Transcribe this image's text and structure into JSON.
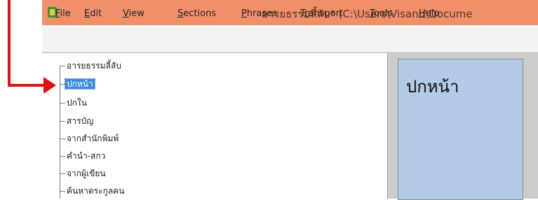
{
  "window": {
    "title": "อารยธรรมลี้ลับ* (C:\\Users\\Visanu\\Docume"
  },
  "menu": [
    {
      "accel": "F",
      "rest": "ile"
    },
    {
      "accel": "E",
      "rest": "dit"
    },
    {
      "accel": "V",
      "rest": "iew"
    },
    {
      "accel": "S",
      "rest": "ections"
    },
    {
      "accel": "P",
      "rest": "hrases"
    },
    {
      "pre": "T",
      "accel": "r",
      "rest": "ansport"
    },
    {
      "accel": "T",
      "rest": "ools"
    },
    {
      "accel": "H",
      "rest": "elp"
    }
  ],
  "tree": {
    "items": [
      "อารยธรรมลี้ลับ",
      "ปกหน้า",
      "ปกใน",
      "สารบัญ",
      "จากสำนักพิมพ์",
      "คำนำ-สกว",
      "จากผู้เขียน",
      "ค้นหาตระกูลคน"
    ],
    "selected": "ปกหน้า"
  },
  "page": {
    "title": "ปกหน้า"
  },
  "colors": {
    "titlebar": "#f0906a",
    "selection": "#3c8ce0",
    "page_panel": "#b3cbe6",
    "annotation": "#e01010"
  }
}
